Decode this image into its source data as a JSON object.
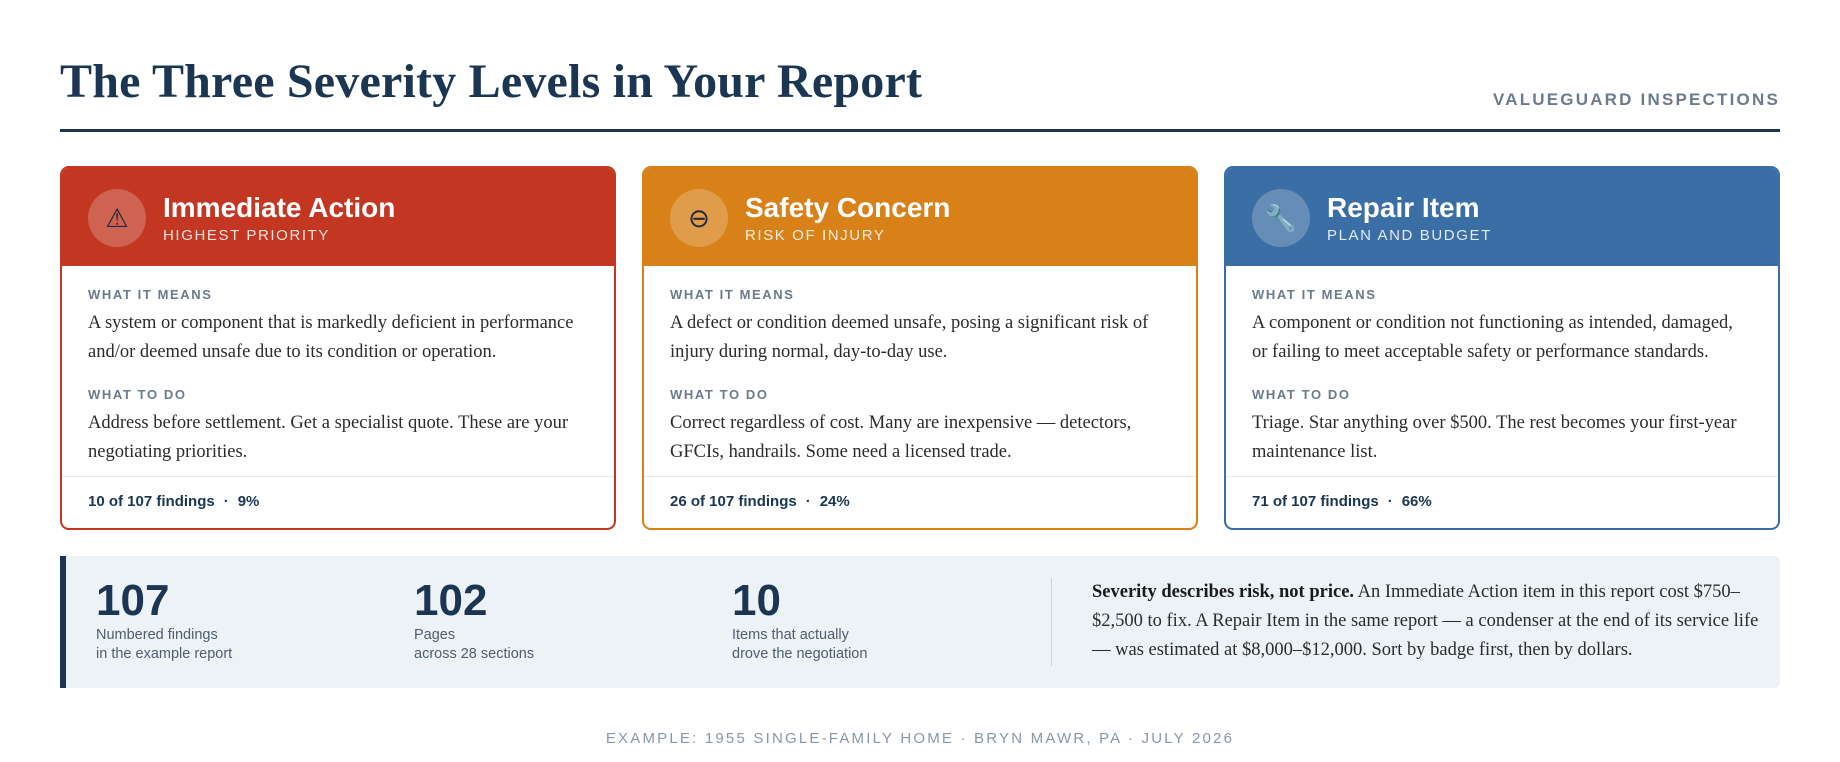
{
  "header": {
    "title": "The Three Severity Levels in Your Report",
    "brand": "VALUEGUARD INSPECTIONS"
  },
  "cards": [
    {
      "title": "Immediate Action",
      "subtitle": "HIGHEST PRIORITY",
      "icon": "warning-triangle-icon",
      "icon_glyph": "⚠",
      "color": "#c33622",
      "means_label": "WHAT IT MEANS",
      "means_text": "A system or component that is markedly deficient in performance and/or deemed unsafe due to its condition or operation.",
      "todo_label": "WHAT TO DO",
      "todo_text": "Address before settlement. Get a specialist quote. These are your negotiating priorities.",
      "count": "10 of 107 findings",
      "sep": "·",
      "percent": "9%"
    },
    {
      "title": "Safety Concern",
      "subtitle": "RISK OF INJURY",
      "icon": "minus-circle-icon",
      "icon_glyph": "⊖",
      "color": "#d98119",
      "means_label": "WHAT IT MEANS",
      "means_text": "A defect or condition deemed unsafe, posing a significant risk of injury during normal, day-to-day use.",
      "todo_label": "WHAT TO DO",
      "todo_text": "Correct regardless of cost. Many are inexpensive — detectors, GFCIs, handrails. Some need a licensed trade.",
      "count": "26 of 107 findings",
      "sep": "·",
      "percent": "24%"
    },
    {
      "title": "Repair Item",
      "subtitle": "PLAN AND BUDGET",
      "icon": "wrench-icon",
      "icon_glyph": "🔧",
      "color": "#3b6ea5",
      "means_label": "WHAT IT MEANS",
      "means_text": "A component or condition not functioning as intended, damaged, or failing to meet acceptable safety or performance standards.",
      "todo_label": "WHAT TO DO",
      "todo_text": "Triage. Star anything over $500. The rest becomes your first-year maintenance list.",
      "count": "71 of 107 findings",
      "sep": "·",
      "percent": "66%"
    }
  ],
  "stats": [
    {
      "value": "107",
      "line1": "Numbered findings",
      "line2": "in the example report"
    },
    {
      "value": "102",
      "line1": "Pages",
      "line2": "across 28 sections"
    },
    {
      "value": "10",
      "line1": "Items that actually",
      "line2": "drove the negotiation"
    }
  ],
  "note": {
    "lead": "Severity describes risk, not price.",
    "body": " An Immediate Action item in this report cost $750–$2,500 to fix. A Repair Item in the same report — a condenser at the end of its service life — was estimated at $8,000–$12,000. Sort by badge first, then by dollars."
  },
  "footer": "EXAMPLE: 1955 SINGLE-FAMILY HOME · BRYN MAWR, PA · JULY 2026"
}
